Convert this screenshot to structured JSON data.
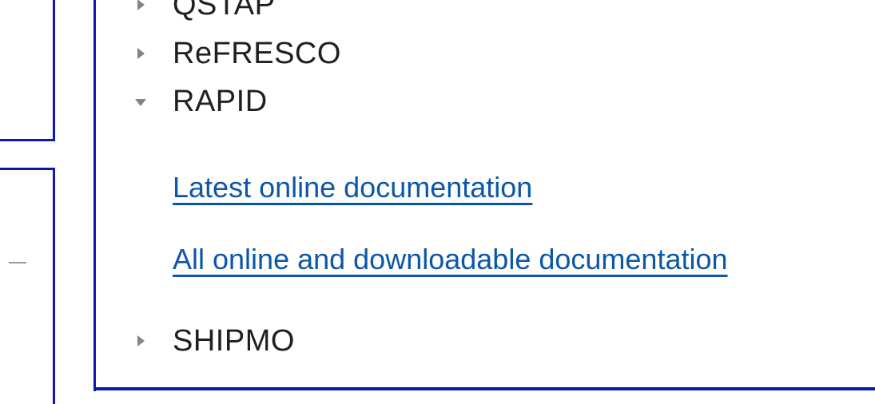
{
  "tree": {
    "items": [
      {
        "label": "QSTAP",
        "state": "collapsed"
      },
      {
        "label": "ReFRESCO",
        "state": "collapsed"
      },
      {
        "label": "RAPID",
        "state": "expanded"
      },
      {
        "label": "SHIPMO",
        "state": "collapsed"
      }
    ],
    "rapid_links": [
      {
        "label": "Latest online documentation"
      },
      {
        "label": "All online and downloadable documentation"
      }
    ]
  },
  "colors": {
    "frame_line": "#0b16b7",
    "link": "#0c57a8",
    "text": "#202020",
    "toggle": "#858585"
  },
  "icons": {
    "collapsed": "triangle-right-icon",
    "expanded": "triangle-down-icon"
  }
}
